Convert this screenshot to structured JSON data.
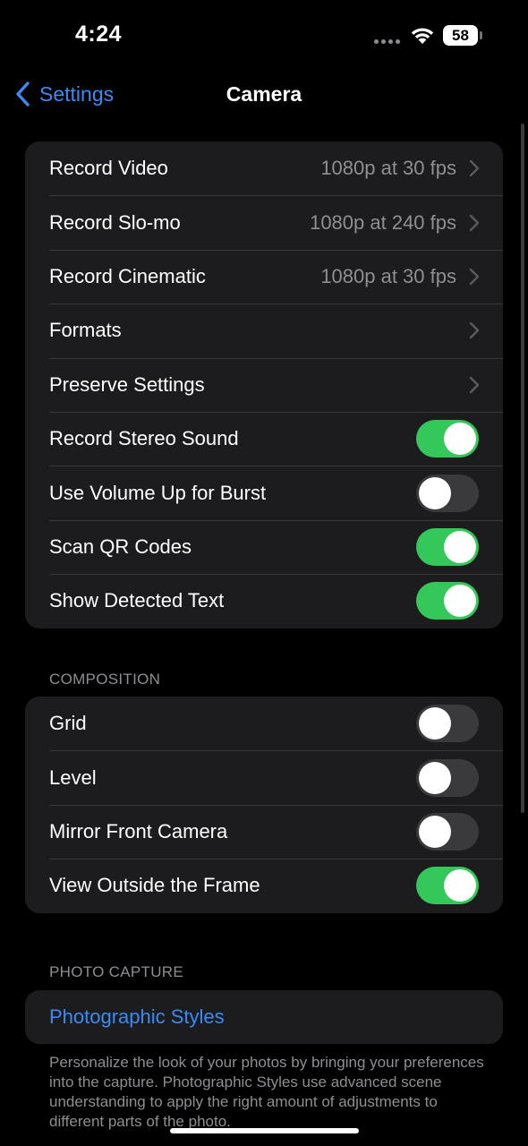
{
  "status_bar": {
    "time": "4:24",
    "battery": "58"
  },
  "nav": {
    "back_label": "Settings",
    "title": "Camera"
  },
  "recording_group": {
    "rows": [
      {
        "label": "Record Video",
        "value": "1080p at 30 fps"
      },
      {
        "label": "Record Slo-mo",
        "value": "1080p at 240 fps"
      },
      {
        "label": "Record Cinematic",
        "value": "1080p at 30 fps"
      },
      {
        "label": "Formats"
      },
      {
        "label": "Preserve Settings"
      },
      {
        "label": "Record Stereo Sound",
        "toggle": true
      },
      {
        "label": "Use Volume Up for Burst",
        "toggle": false
      },
      {
        "label": "Scan QR Codes",
        "toggle": true
      },
      {
        "label": "Show Detected Text",
        "toggle": true
      }
    ]
  },
  "composition": {
    "header": "COMPOSITION",
    "rows": [
      {
        "label": "Grid",
        "toggle": false
      },
      {
        "label": "Level",
        "toggle": false
      },
      {
        "label": "Mirror Front Camera",
        "toggle": false
      },
      {
        "label": "View Outside the Frame",
        "toggle": true
      }
    ]
  },
  "photo_capture": {
    "header": "PHOTO CAPTURE",
    "link_label": "Photographic Styles",
    "footnote": "Personalize the look of your photos by bringing your preferences into the capture. Photographic Styles use advanced scene understanding to apply the right amount of adjustments to different parts of the photo."
  },
  "colors": {
    "accent": "#3a8bf5",
    "toggle_on": "#34c759",
    "toggle_off": "#3a3a3c",
    "group_background": "#1c1c1e"
  }
}
